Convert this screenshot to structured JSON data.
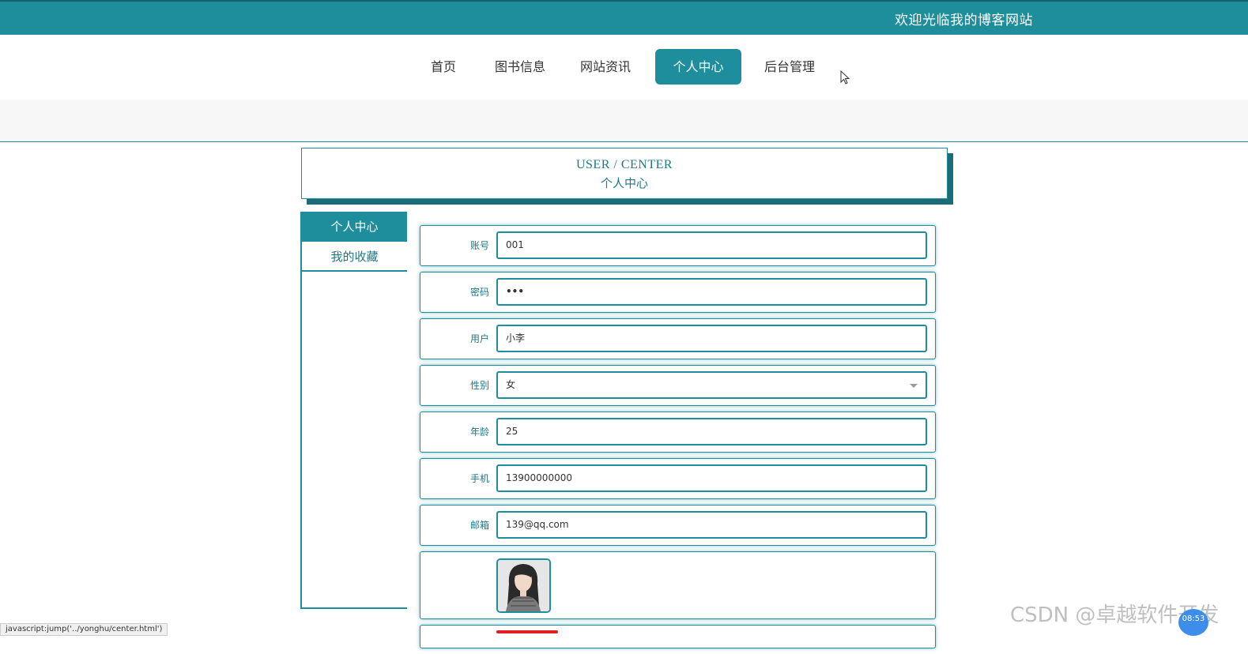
{
  "header": {
    "welcome": "欢迎光临我的博客网站"
  },
  "nav": {
    "items": [
      "首页",
      "图书信息",
      "网站资讯",
      "个人中心",
      "后台管理"
    ],
    "active_index": 3
  },
  "title": {
    "en": "USER / CENTER",
    "cn": "个人中心"
  },
  "sidebar": {
    "items": [
      "个人中心",
      "我的收藏"
    ],
    "active_index": 0
  },
  "form": {
    "account": {
      "label": "账号",
      "value": "001"
    },
    "password": {
      "label": "密码",
      "value": "•••"
    },
    "user": {
      "label": "用户",
      "value": "小李"
    },
    "gender": {
      "label": "性别",
      "value": "女"
    },
    "age": {
      "label": "年龄",
      "value": "25"
    },
    "phone": {
      "label": "手机",
      "value": "13900000000"
    },
    "email": {
      "label": "邮箱",
      "value": "139@qq.com"
    }
  },
  "status_bar": "javascript:jump('../yonghu/center.html')",
  "watermark": "CSDN @卓越软件开发",
  "time_badge": "08:53",
  "colors": {
    "primary": "#1e8e9c",
    "dark": "#14616b",
    "accent_red": "#e02020"
  }
}
